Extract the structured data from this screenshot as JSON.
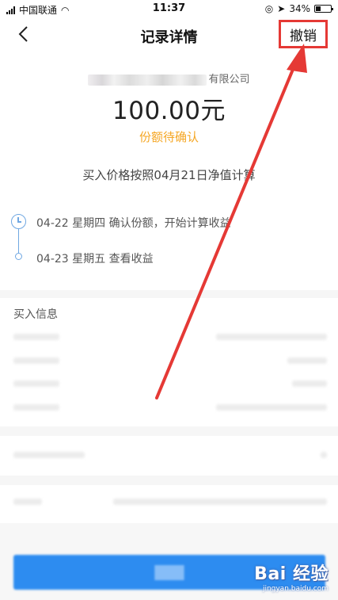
{
  "status_bar": {
    "carrier": "中国联通",
    "time": "11:37",
    "battery_text": "34%",
    "battery_level": 0.34
  },
  "nav": {
    "title": "记录详情",
    "revoke_label": "撤销"
  },
  "summary": {
    "company_suffix": "有限公司",
    "amount": "100.00元",
    "status": "份额待确认",
    "price_note": "买入价格按照04月21日净值计算"
  },
  "timeline": [
    {
      "text": "04-22 星期四  确认份额，开始计算收益"
    },
    {
      "text": "04-23 星期五  查看收益"
    }
  ],
  "buy_info": {
    "title": "买入信息"
  },
  "watermark": {
    "logo": "Bai 经验",
    "url": "jingyan.baidu.com"
  },
  "colors": {
    "accent_orange": "#f5a623",
    "timeline_blue": "#6fa7e2",
    "button_blue": "#2d8cf0",
    "annotation_red": "#e53935"
  },
  "icons": [
    "back-chevron-icon",
    "clock-icon",
    "wifi-icon",
    "location-arrow-icon",
    "battery-icon"
  ]
}
